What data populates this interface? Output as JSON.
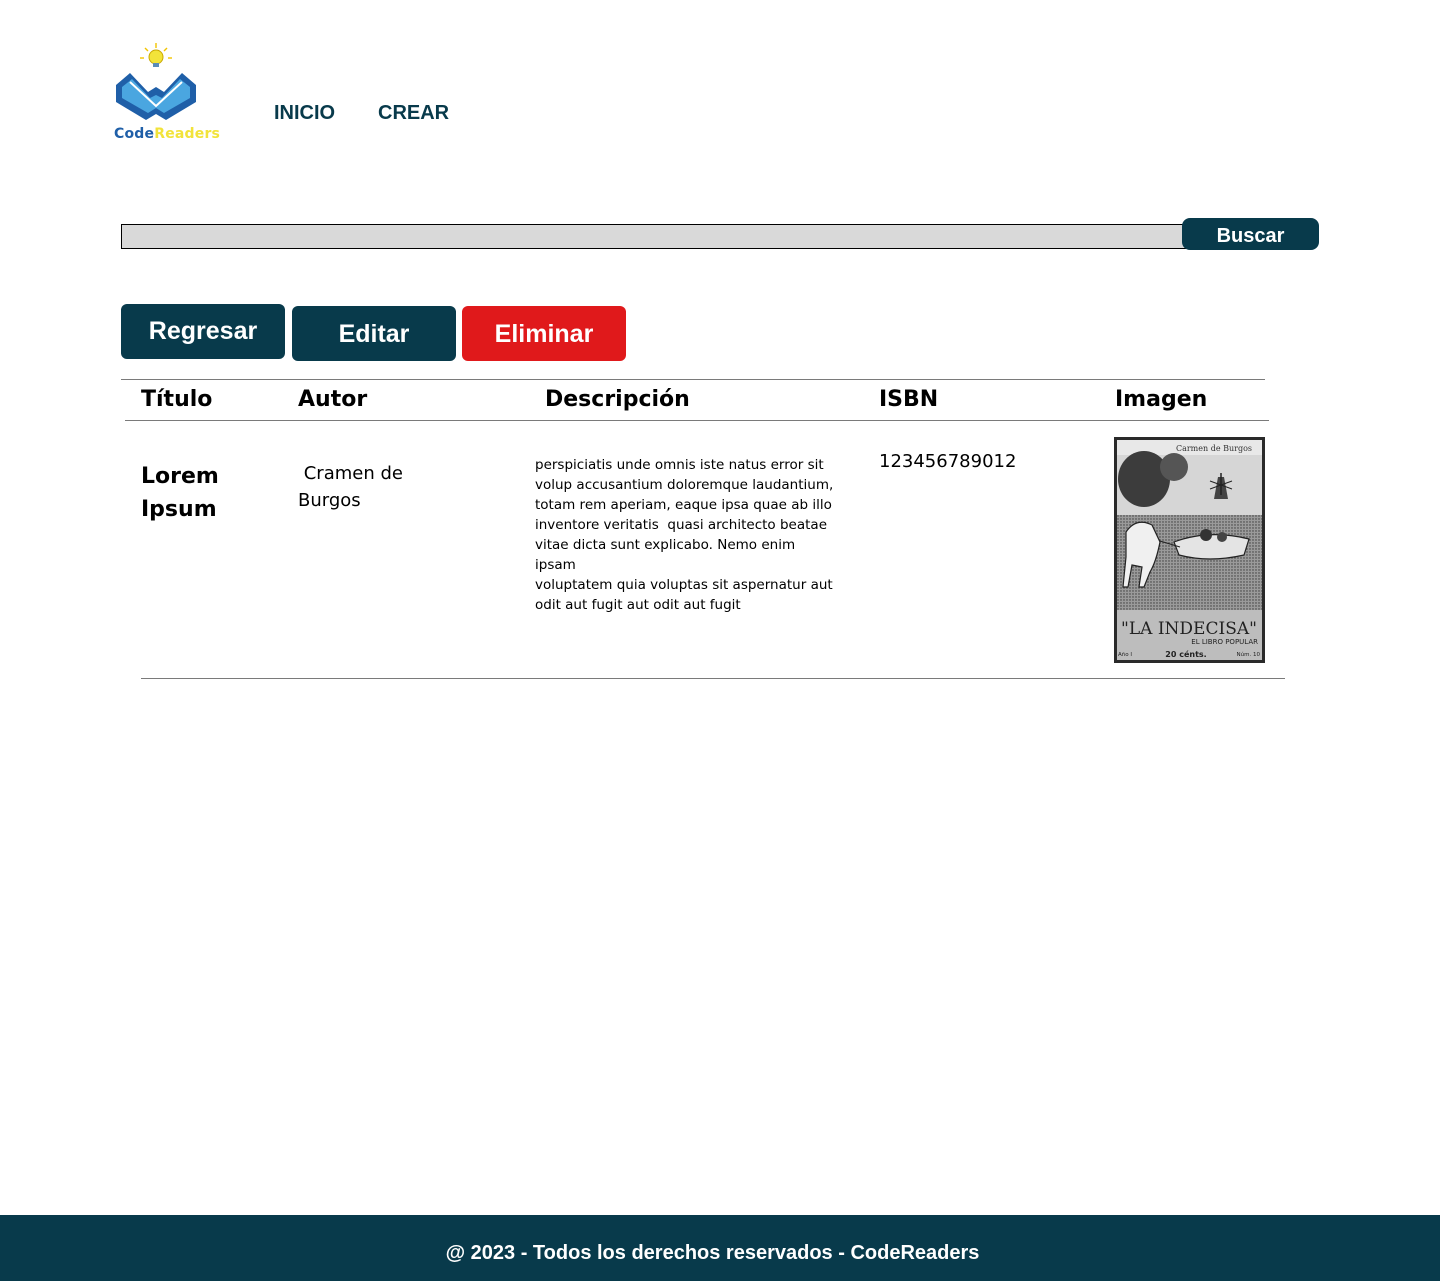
{
  "logo": {
    "word_code": "Code",
    "word_readers": "Readers"
  },
  "nav": {
    "home": "INICIO",
    "create": "CREAR"
  },
  "search": {
    "value": "",
    "button": "Buscar"
  },
  "actions": {
    "back": "Regresar",
    "edit": "Editar",
    "delete": "Eliminar"
  },
  "table": {
    "headers": {
      "title": "Título",
      "author": "Autor",
      "description": "Descripción",
      "isbn": "ISBN",
      "image": "Imagen"
    },
    "rows": [
      {
        "title": "Lorem Ipsum",
        "author": " Cramen de\nBurgos",
        "description": "perspiciatis unde omnis iste natus error sit\nvolup accusantium doloremque laudantium,\ntotam rem aperiam, eaque ipsa quae ab illo\ninventore veritatis  quasi architecto beatae\nvitae dicta sunt explicabo. Nemo enim ipsam\nvoluptatem quia voluptas sit aspernatur aut\nodit aut fugit aut odit aut fugit",
        "isbn": "123456789012",
        "cover": {
          "author_line": "Carmen de Burgos",
          "book_title": "\"LA INDECISA\"",
          "collection": "EL LIBRO POPULAR",
          "price": "20 cénts.",
          "year": "Año I",
          "number": "Núm. 10"
        }
      }
    ]
  },
  "footer": {
    "text": "@ 2023 - Todos los derechos reservados - CodeReaders"
  },
  "colors": {
    "primary": "#083a4b",
    "danger": "#e0191b",
    "search_bg": "#d9d9d9",
    "logo_blue": "#1f5fa8",
    "logo_yellow": "#f2e33a"
  }
}
